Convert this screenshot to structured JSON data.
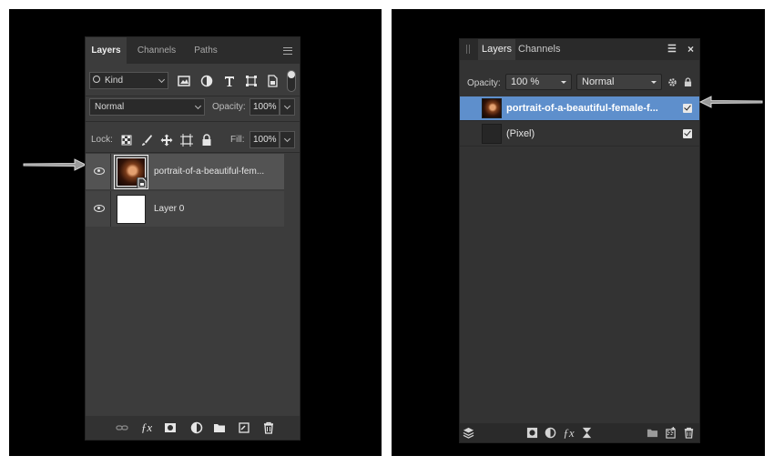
{
  "photoshop": {
    "tabs": [
      {
        "label": "Layers",
        "active": true
      },
      {
        "label": "Channels",
        "active": false
      },
      {
        "label": "Paths",
        "active": false
      }
    ],
    "filter": {
      "kind_label": "Kind"
    },
    "blend_mode": "Normal",
    "opacity": {
      "label": "Opacity:",
      "value": "100%"
    },
    "lock": {
      "label": "Lock:"
    },
    "fill": {
      "label": "Fill:",
      "value": "100%"
    },
    "layers": [
      {
        "name": "portrait-of-a-beautiful-fem...",
        "visible": true,
        "selected": true,
        "thumbnail": "portrait",
        "smart_object": true
      },
      {
        "name": "Layer 0",
        "visible": true,
        "selected": false,
        "thumbnail": "white"
      }
    ],
    "footer_icons": [
      "link-icon",
      "fx-icon",
      "mask-icon",
      "adjustment-icon",
      "folder-icon",
      "new-layer-icon",
      "trash-icon"
    ]
  },
  "affinity": {
    "tabs": [
      {
        "label": "Layers",
        "active": true
      },
      {
        "label": "Channels",
        "active": false
      }
    ],
    "opacity": {
      "label": "Opacity:",
      "value": "100 %"
    },
    "blend_mode": "Normal",
    "layers": [
      {
        "name": "portrait-of-a-beautiful-female-f...",
        "checked": true,
        "selected": true,
        "thumbnail": "portrait"
      },
      {
        "name": "(Pixel)",
        "checked": true,
        "selected": false,
        "thumbnail": "dark"
      }
    ],
    "footer_icons": [
      "layers-icon",
      "mask-icon",
      "adjustment-icon",
      "fx-icon",
      "hourglass-icon",
      "folder-icon",
      "new-layer-icon",
      "trash-icon"
    ]
  },
  "colors": {
    "selection_blue": "#5e8fcc",
    "panel_dark": "#3c3c3c",
    "background": "#000000"
  }
}
